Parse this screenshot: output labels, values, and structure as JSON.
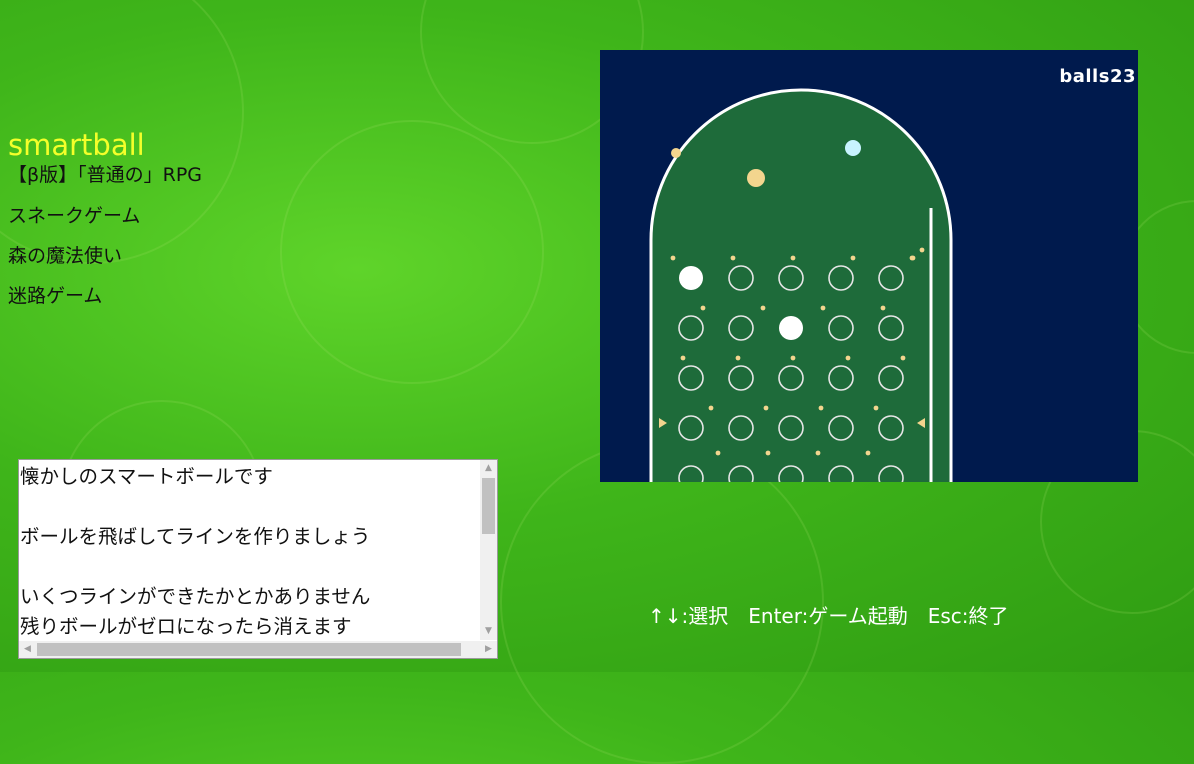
{
  "menu": {
    "title": "smartball",
    "items": [
      "【β版】「普通の」RPG",
      "スネークゲーム",
      "森の魔法使い",
      "迷路ゲーム"
    ]
  },
  "description": {
    "lines": [
      "懐かしのスマートボールです",
      "",
      "ボールを飛ばしてラインを作りましょう",
      "",
      "いくつラインができたかとかありません",
      "残りボールがゼロになったら消えます"
    ]
  },
  "game": {
    "balls_label": "balls",
    "balls_count": "23",
    "colors": {
      "background": "#001a4d",
      "field": "#1e6b3a",
      "rail": "#ffffff",
      "ball": "#ffffff",
      "ball_cyan": "#c8f4ff",
      "ball_gold": "#f3d58e",
      "pin": "#f3d58e"
    }
  },
  "help": "↑↓:選択　Enter:ゲーム起動　Esc:終了"
}
